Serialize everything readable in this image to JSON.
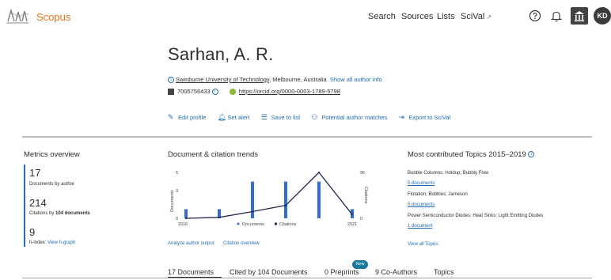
{
  "header": {
    "brand": "Scopus",
    "nav": {
      "search": "Search",
      "sources": "Sources",
      "lists": "Lists",
      "scival": "SciVal",
      "scival_arrow": "↗"
    },
    "avatar_initials": "KD",
    "icons": [
      "elsevier-logo",
      "help-icon",
      "bell-icon",
      "institution-icon"
    ]
  },
  "author": {
    "name": "Sarhan, A. R.",
    "affiliation_link": "Swinburne University of Technology",
    "affiliation_rest": ", Melbourne, Australia",
    "show_all": "Show all author info",
    "scopus_id": "7005756433",
    "orcid": "https://orcid.org/0000-0003-1789-5798"
  },
  "actions": {
    "edit_profile": "Edit profile",
    "set_alert": "Set alert",
    "save_to_list": "Save to list",
    "potential_matches": "Potential author matches",
    "export_scival": "Export to SciVal"
  },
  "metrics": {
    "title": "Metrics overview",
    "documents_value": "17",
    "documents_label": "Documents by author",
    "citations_value": "214",
    "citations_label_pre": "Citations by ",
    "citations_label_bold": "104 documents",
    "hindex_value": "9",
    "hindex_label": "h-index: ",
    "hindex_link": "View h-graph"
  },
  "trends": {
    "title": "Document & citation trends",
    "analyze_link": "Analyze author output",
    "citation_link": "Citation overview"
  },
  "chart_data": {
    "type": "bar",
    "x": [
      2016,
      2017,
      2018,
      2019,
      2020,
      2021
    ],
    "xlim": [
      2016,
      2021
    ],
    "xtick_labels": [
      "2016",
      "2021"
    ],
    "ylabel_left": "Documents",
    "ylabel_right": "Citations",
    "ylim_left": [
      0,
      5
    ],
    "ylim_right": [
      0,
      96
    ],
    "left_ticks": [
      "5",
      "3",
      "0"
    ],
    "right_ticks": [
      "96",
      "0"
    ],
    "series": [
      {
        "name": "Documents",
        "type": "bar",
        "color": "#2f6fd3",
        "values": [
          1,
          1,
          4,
          4,
          4,
          1
        ]
      },
      {
        "name": "Citations",
        "type": "line",
        "color": "#22284f",
        "values": [
          0,
          2,
          14,
          27,
          96,
          8
        ]
      }
    ],
    "legend": "bottom"
  },
  "topics": {
    "title": "Most contributed Topics 2015–2019",
    "items": [
      {
        "name": "Bubble Columns; Holdup; Bubbly Flow",
        "docs": "5 documents"
      },
      {
        "name": "Flotation; Bubbles; Jameson",
        "docs": "5 documents"
      },
      {
        "name": "Power Semiconductor Diodes; Heat Sinks; Light Emitting Diodes",
        "docs": "1 document"
      }
    ],
    "view_all": "View all Topics"
  },
  "tabs": {
    "documents": "17 Documents",
    "cited_by": "Cited by 104 Documents",
    "preprints": "0 Preprints",
    "new_badge": "New",
    "coauthors": "9 Co-Authors",
    "topics": "Topics"
  }
}
